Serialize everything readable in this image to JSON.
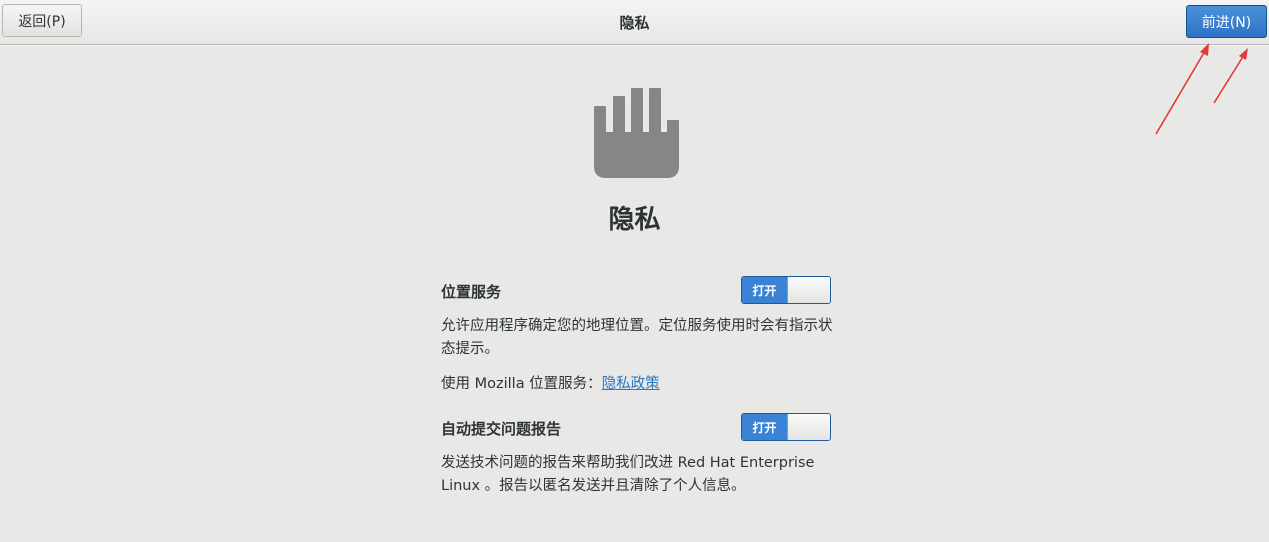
{
  "header": {
    "back_label": "返回(P)",
    "title": "隐私",
    "next_label": "前进(N)"
  },
  "page": {
    "icon": "raised-hand-icon",
    "title": "隐私"
  },
  "location": {
    "label": "位置服务",
    "toggle_label": "打开",
    "description": "允许应用程序确定您的地理位置。定位服务使用时会有指示状态提示。",
    "mozilla_prefix": "使用 Mozilla 位置服务：",
    "policy_link": "隐私政策"
  },
  "reports": {
    "label": "自动提交问题报告",
    "toggle_label": "打开",
    "description": "发送技术问题的报告来帮助我们改进 Red Hat Enterprise Linux 。报告以匿名发送并且清除了个人信息。"
  },
  "annotation": {
    "color": "#e53935"
  }
}
